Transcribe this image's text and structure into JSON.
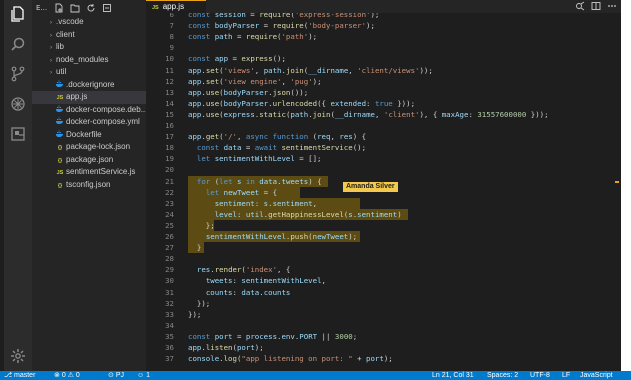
{
  "explorer": {
    "title": "E...",
    "items": [
      {
        "label": ".vscode",
        "type": "folder"
      },
      {
        "label": "client",
        "type": "folder"
      },
      {
        "label": "lib",
        "type": "folder"
      },
      {
        "label": "node_modules",
        "type": "folder"
      },
      {
        "label": "util",
        "type": "folder"
      },
      {
        "label": ".dockerignore",
        "type": "file",
        "icon": "docker-icon"
      },
      {
        "label": "app.js",
        "type": "file",
        "icon": "js-icon",
        "badge": "JS",
        "selected": true
      },
      {
        "label": "docker-compose.deb...",
        "type": "file",
        "icon": "docker-icon"
      },
      {
        "label": "docker-compose.yml",
        "type": "file",
        "icon": "docker-icon"
      },
      {
        "label": "Dockerfile",
        "type": "file",
        "icon": "docker-icon"
      },
      {
        "label": "package-lock.json",
        "type": "file",
        "icon": "json-icon",
        "badge": "{}"
      },
      {
        "label": "package.json",
        "type": "file",
        "icon": "json-icon",
        "badge": "{}"
      },
      {
        "label": "sentimentService.js",
        "type": "file",
        "icon": "js-icon",
        "badge": "JS"
      },
      {
        "label": "tsconfig.json",
        "type": "file",
        "icon": "json-icon",
        "badge": "{}"
      }
    ]
  },
  "tab": {
    "badge": "JS",
    "label": "app.js"
  },
  "editor": {
    "lines": [
      {
        "n": "6",
        "t": "const session = require('express-session');"
      },
      {
        "n": "7",
        "t": "const bodyParser = require('body-parser');"
      },
      {
        "n": "8",
        "t": "const path = require('path');"
      },
      {
        "n": "9",
        "t": ""
      },
      {
        "n": "10",
        "t": "const app = express();"
      },
      {
        "n": "11",
        "t": "app.set('views', path.join(__dirname, 'client/views'));"
      },
      {
        "n": "12",
        "t": "app.set('view engine', 'pug');"
      },
      {
        "n": "13",
        "t": "app.use(bodyParser.json());"
      },
      {
        "n": "14",
        "t": "app.use(bodyParser.urlencoded({ extended: true }));"
      },
      {
        "n": "15",
        "t": "app.use(express.static(path.join(__dirname, 'client'), { maxAge: 31557600000 }));"
      },
      {
        "n": "16",
        "t": ""
      },
      {
        "n": "17",
        "t": "app.get('/', async function (req, res) {"
      },
      {
        "n": "18",
        "t": "  const data = await sentimentService();"
      },
      {
        "n": "19",
        "t": "  let sentimentWithLevel = [];"
      },
      {
        "n": "20",
        "t": ""
      },
      {
        "n": "21",
        "t": "  for (let s in data.tweets) {"
      },
      {
        "n": "22",
        "t": "    let newTweet = {"
      },
      {
        "n": "23",
        "t": "      sentiment: s.sentiment,"
      },
      {
        "n": "24",
        "t": "      level: util.getHappinessLevel(s.sentiment)"
      },
      {
        "n": "25",
        "t": "    };"
      },
      {
        "n": "26",
        "t": "    sentimentWithLevel.push(newTweet);"
      },
      {
        "n": "27",
        "t": "  }"
      },
      {
        "n": "28",
        "t": ""
      },
      {
        "n": "29",
        "t": "  res.render('index', {"
      },
      {
        "n": "30",
        "t": "    tweets: sentimentWithLevel,"
      },
      {
        "n": "31",
        "t": "    counts: data.counts"
      },
      {
        "n": "32",
        "t": "  });"
      },
      {
        "n": "33",
        "t": "});"
      },
      {
        "n": "34",
        "t": ""
      },
      {
        "n": "35",
        "t": "const port = process.env.PORT || 3000;"
      },
      {
        "n": "36",
        "t": "app.listen(port);"
      },
      {
        "n": "37",
        "t": "console.log(\"app listening on port: \" + port);"
      }
    ],
    "collab_flag": "Amanda Silver"
  },
  "statusbar": {
    "branch": "master",
    "problems": "0 ⚠ 0",
    "live_share": "PJ",
    "people": "1",
    "position": "Ln 21, Col 31",
    "spaces": "Spaces: 2",
    "encoding": "UTF-8",
    "eol": "LF",
    "language": "JavaScript"
  },
  "colors": {
    "accent": "#007acc",
    "highlight": "#5c4b12",
    "flag": "#f2c94c"
  }
}
